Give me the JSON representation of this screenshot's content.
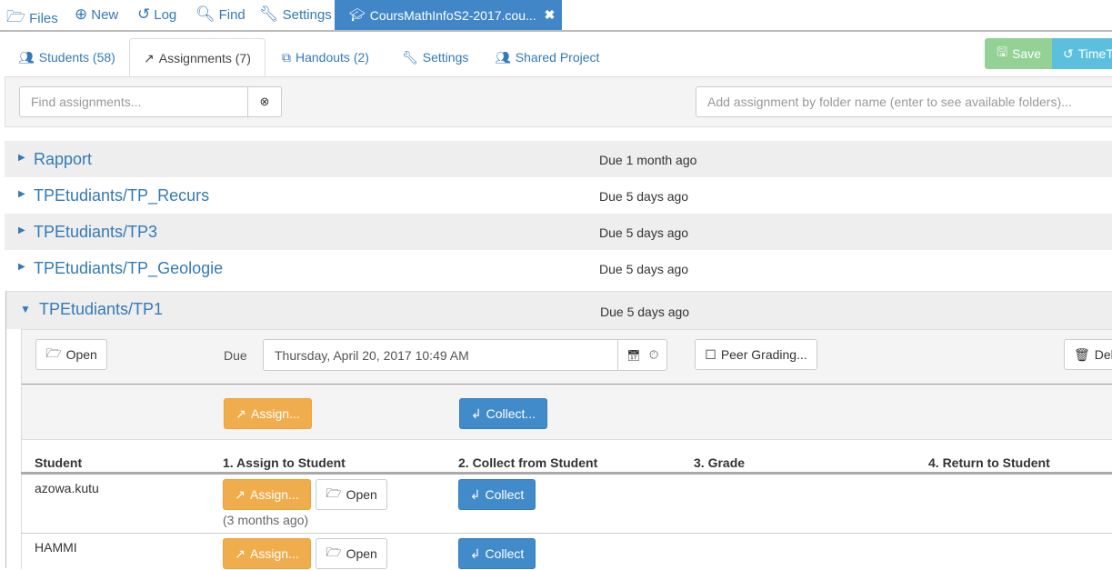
{
  "topnav": {
    "files": "Files",
    "new": "New",
    "log": "Log",
    "find": "Find",
    "settings": "Settings",
    "active_file": "CoursMathInfoS2-2017.cou..."
  },
  "tabs": {
    "students": "Students (58)",
    "assignments": "Assignments (7)",
    "handouts": "Handouts (2)",
    "settings": "Settings",
    "shared": "Shared Project"
  },
  "toolbar": {
    "save": "Save",
    "timetravel": "TimeT"
  },
  "search": {
    "placeholder": "Find assignments...",
    "add_placeholder": "Add assignment by folder name (enter to see available folders)..."
  },
  "assignments": [
    {
      "name": "Rapport",
      "due": "Due 1 month ago"
    },
    {
      "name": "TPEtudiants/TP_Recurs",
      "due": "Due 5 days ago"
    },
    {
      "name": "TPEtudiants/TP3",
      "due": "Due 5 days ago"
    },
    {
      "name": "TPEtudiants/TP_Geologie",
      "due": "Due 5 days ago"
    },
    {
      "name": "TPEtudiants/TP1",
      "due": "Due 5 days ago"
    }
  ],
  "expanded": {
    "open": "Open",
    "due_label": "Due",
    "due_value": "Thursday, April 20, 2017 10:49 AM",
    "peer": "Peer Grading...",
    "delete": "Dele",
    "assign_all": "Assign...",
    "collect_all": "Collect...",
    "headers": [
      "Student",
      "1. Assign to Student",
      "2. Collect from Student",
      "3. Grade",
      "4. Return to Student"
    ],
    "students": [
      {
        "name": "azowa.kutu",
        "assign": "Assign...",
        "open": "Open",
        "collect": "Collect",
        "note": "(3 months ago)"
      },
      {
        "name": "HAMMI",
        "assign": "Assign...",
        "open": "Open",
        "collect": "Collect"
      }
    ]
  }
}
